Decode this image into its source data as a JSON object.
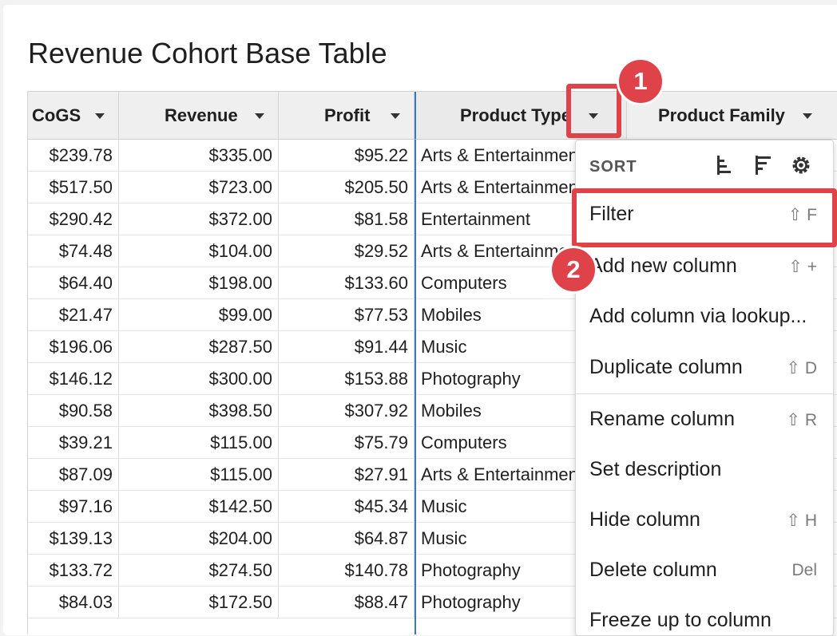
{
  "page": {
    "title": "Revenue Cohort Base Table"
  },
  "table": {
    "columns": [
      {
        "label": "CoGS"
      },
      {
        "label": "Revenue"
      },
      {
        "label": "Profit"
      },
      {
        "label": "Product Type"
      },
      {
        "label": "Product Family"
      }
    ],
    "rows": [
      {
        "cogs": "$239.78",
        "revenue": "$335.00",
        "profit": "$95.22",
        "product_type": "Arts & Entertainment"
      },
      {
        "cogs": "$517.50",
        "revenue": "$723.00",
        "profit": "$205.50",
        "product_type": "Arts & Entertainment"
      },
      {
        "cogs": "$290.42",
        "revenue": "$372.00",
        "profit": "$81.58",
        "product_type": "Entertainment"
      },
      {
        "cogs": "$74.48",
        "revenue": "$104.00",
        "profit": "$29.52",
        "product_type": "Arts & Entertainment"
      },
      {
        "cogs": "$64.40",
        "revenue": "$198.00",
        "profit": "$133.60",
        "product_type": "Computers"
      },
      {
        "cogs": "$21.47",
        "revenue": "$99.00",
        "profit": "$77.53",
        "product_type": "Mobiles"
      },
      {
        "cogs": "$196.06",
        "revenue": "$287.50",
        "profit": "$91.44",
        "product_type": "Music"
      },
      {
        "cogs": "$146.12",
        "revenue": "$300.00",
        "profit": "$153.88",
        "product_type": "Photography"
      },
      {
        "cogs": "$90.58",
        "revenue": "$398.50",
        "profit": "$307.92",
        "product_type": "Mobiles"
      },
      {
        "cogs": "$39.21",
        "revenue": "$115.00",
        "profit": "$75.79",
        "product_type": "Computers"
      },
      {
        "cogs": "$87.09",
        "revenue": "$115.00",
        "profit": "$27.91",
        "product_type": "Arts & Entertainment"
      },
      {
        "cogs": "$97.16",
        "revenue": "$142.50",
        "profit": "$45.34",
        "product_type": "Music"
      },
      {
        "cogs": "$139.13",
        "revenue": "$204.00",
        "profit": "$64.87",
        "product_type": "Music"
      },
      {
        "cogs": "$133.72",
        "revenue": "$274.50",
        "profit": "$140.78",
        "product_type": "Photography"
      },
      {
        "cogs": "$84.03",
        "revenue": "$172.50",
        "profit": "$88.47",
        "product_type": "Photography"
      }
    ]
  },
  "menu": {
    "sort_label": "SORT",
    "sort_icons": [
      "sort-ascending-icon",
      "sort-descending-icon",
      "gear-icon"
    ],
    "items": [
      {
        "label": "Filter",
        "shortcut": "⇧ F"
      },
      {
        "label": "Add new column",
        "shortcut": "⇧ +"
      },
      {
        "label": "Add column via lookup...",
        "shortcut": ""
      },
      {
        "label": "Duplicate column",
        "shortcut": "⇧ D"
      },
      {
        "label": "Rename column",
        "shortcut": "⇧ R"
      },
      {
        "label": "Set description",
        "shortcut": ""
      },
      {
        "label": "Hide column",
        "shortcut": "⇧ H"
      },
      {
        "label": "Delete column",
        "shortcut": "Del"
      },
      {
        "label": "Freeze up to column",
        "shortcut": ""
      }
    ]
  },
  "annotations": {
    "step1": "1",
    "step2": "2"
  },
  "colors": {
    "highlight": "#e0424a",
    "active_column": "#3a78c2",
    "header_bg": "#efefef"
  }
}
